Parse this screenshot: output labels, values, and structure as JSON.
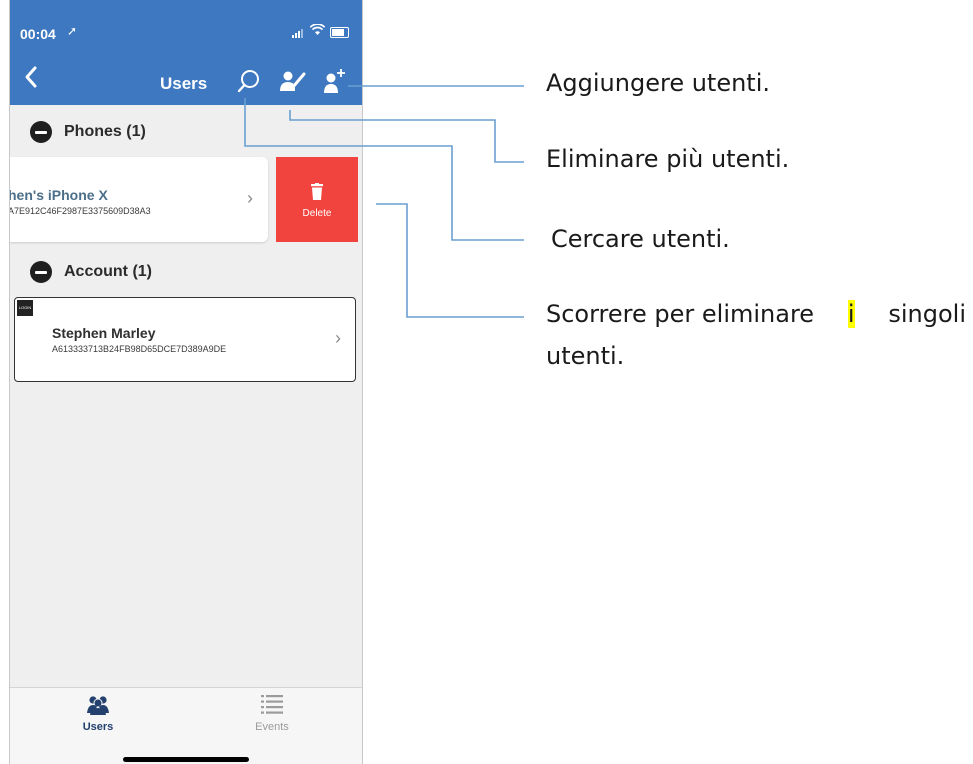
{
  "status_bar": {
    "time": "00:04",
    "location_icon": "location-arrow-icon"
  },
  "nav": {
    "title": "Users",
    "back_icon": "chevron-left-icon",
    "search_icon": "search-icon",
    "multi_delete_icon": "user-edit-icon",
    "add_user_icon": "user-add-icon"
  },
  "sections": [
    {
      "header": "Phones (1)",
      "rows": [
        {
          "title": "hen's iPhone X",
          "subtitle": "A7E912C46F2987E3375609D38A3",
          "swiped": true,
          "action_label": "Delete"
        }
      ]
    },
    {
      "header": "Account (1)",
      "rows": [
        {
          "badge": "LOGIN",
          "title": "Stephen Marley",
          "subtitle": "A613333713B24FB98D65DCE7D389A9DE"
        }
      ]
    }
  ],
  "tabs": [
    {
      "label": "Users",
      "icon": "users-icon",
      "active": true
    },
    {
      "label": "Events",
      "icon": "list-icon",
      "active": false
    }
  ],
  "annotations": {
    "add_users": "Aggiungere utenti.",
    "delete_multiple": "Eliminare più utenti.",
    "search_users": "Cercare utenti.",
    "swipe_line1_before": "Scorrere per eliminare ",
    "swipe_line1_highlight": "i",
    "swipe_line1_after": " singoli",
    "swipe_line2": "utenti.",
    "line_color": "#6a9fd0",
    "highlight_color": "#ffff00"
  },
  "colors": {
    "brand_blue": "#3d78c0",
    "delete_red": "#f2443f"
  }
}
